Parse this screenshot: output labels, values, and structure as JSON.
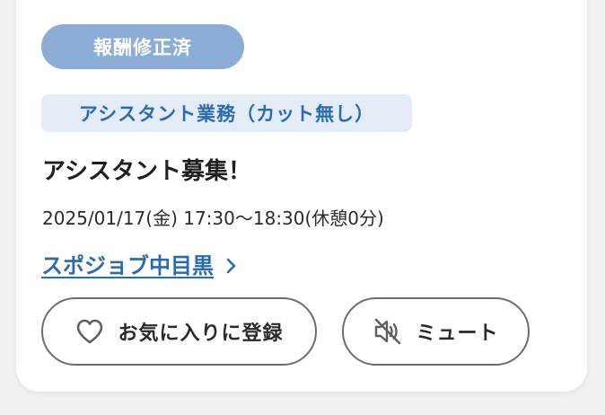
{
  "job": {
    "status_badge": "報酬修正済",
    "category_badge": "アシスタント業務（カット無し）",
    "title": "アシスタント募集！",
    "datetime": "2025/01/17(金) 17:30〜18:30(休憩0分)",
    "company_name": "スポジョブ中目黒"
  },
  "actions": {
    "favorite_label": "お気に入りに登録",
    "mute_label": "ミュート"
  },
  "icons": {
    "company_link": "chevron-right-icon",
    "favorite": "heart-icon",
    "mute": "speaker-muted-icon"
  },
  "colors": {
    "status_badge_bg": "#8badd6",
    "category_badge_bg": "#e3ecf7",
    "link_blue": "#2a6cb0"
  }
}
